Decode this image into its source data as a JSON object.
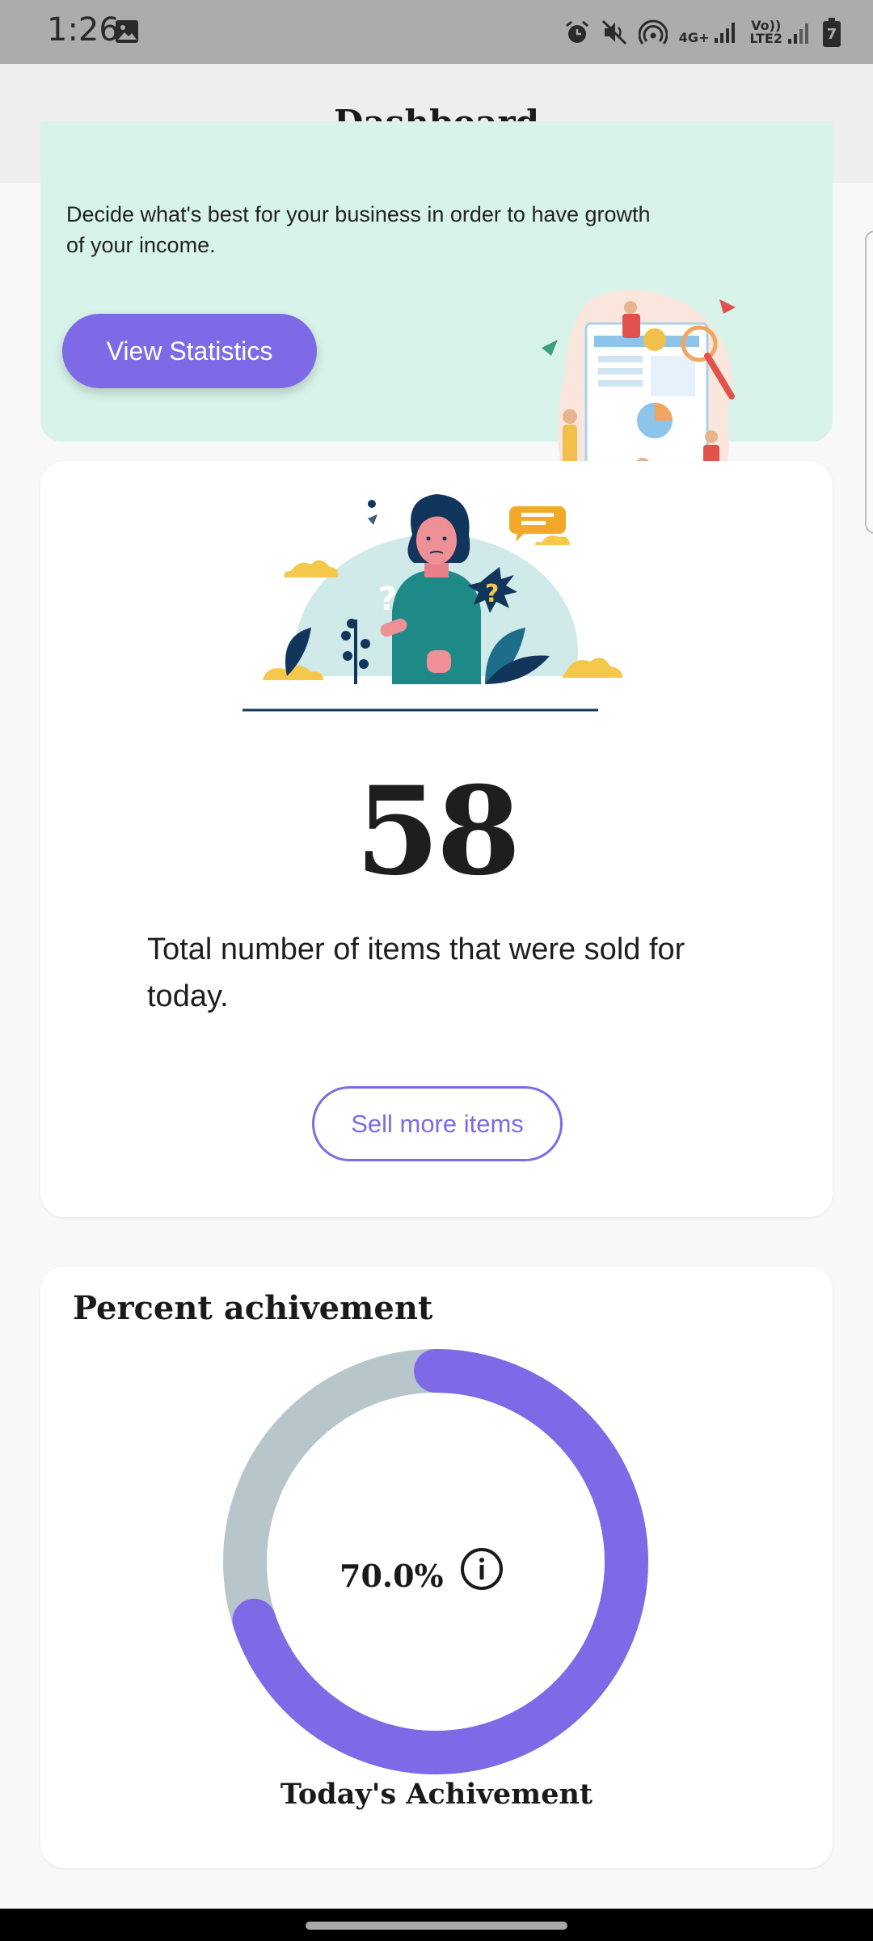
{
  "status_bar": {
    "time": "1:26",
    "icons": [
      "image-icon",
      "alarm-icon",
      "mute-icon",
      "hotspot-icon",
      "signal-4g-icon",
      "signal-volte-icon",
      "battery-icon"
    ],
    "network_4g": "4G+",
    "network_volte_top": "Vo))",
    "network_volte_bottom": "LTE2",
    "battery_level": "7"
  },
  "app_bar": {
    "title": "Dashboard"
  },
  "promo": {
    "description": "Decide what's best for your business in order to have growth of your income.",
    "button_label": "View Statistics"
  },
  "sold_card": {
    "count": "58",
    "description": "Total number of items that were sold for today.",
    "button_label": "Sell more items"
  },
  "achievement_card": {
    "title": "Percent achivement",
    "percent_text": "70.0%",
    "percent_value": 0.7,
    "caption": "Today's Achivement"
  },
  "colors": {
    "accent": "#7e6ae6",
    "promo_bg": "#d8f3e9",
    "ring_track": "#b7c6cb"
  }
}
